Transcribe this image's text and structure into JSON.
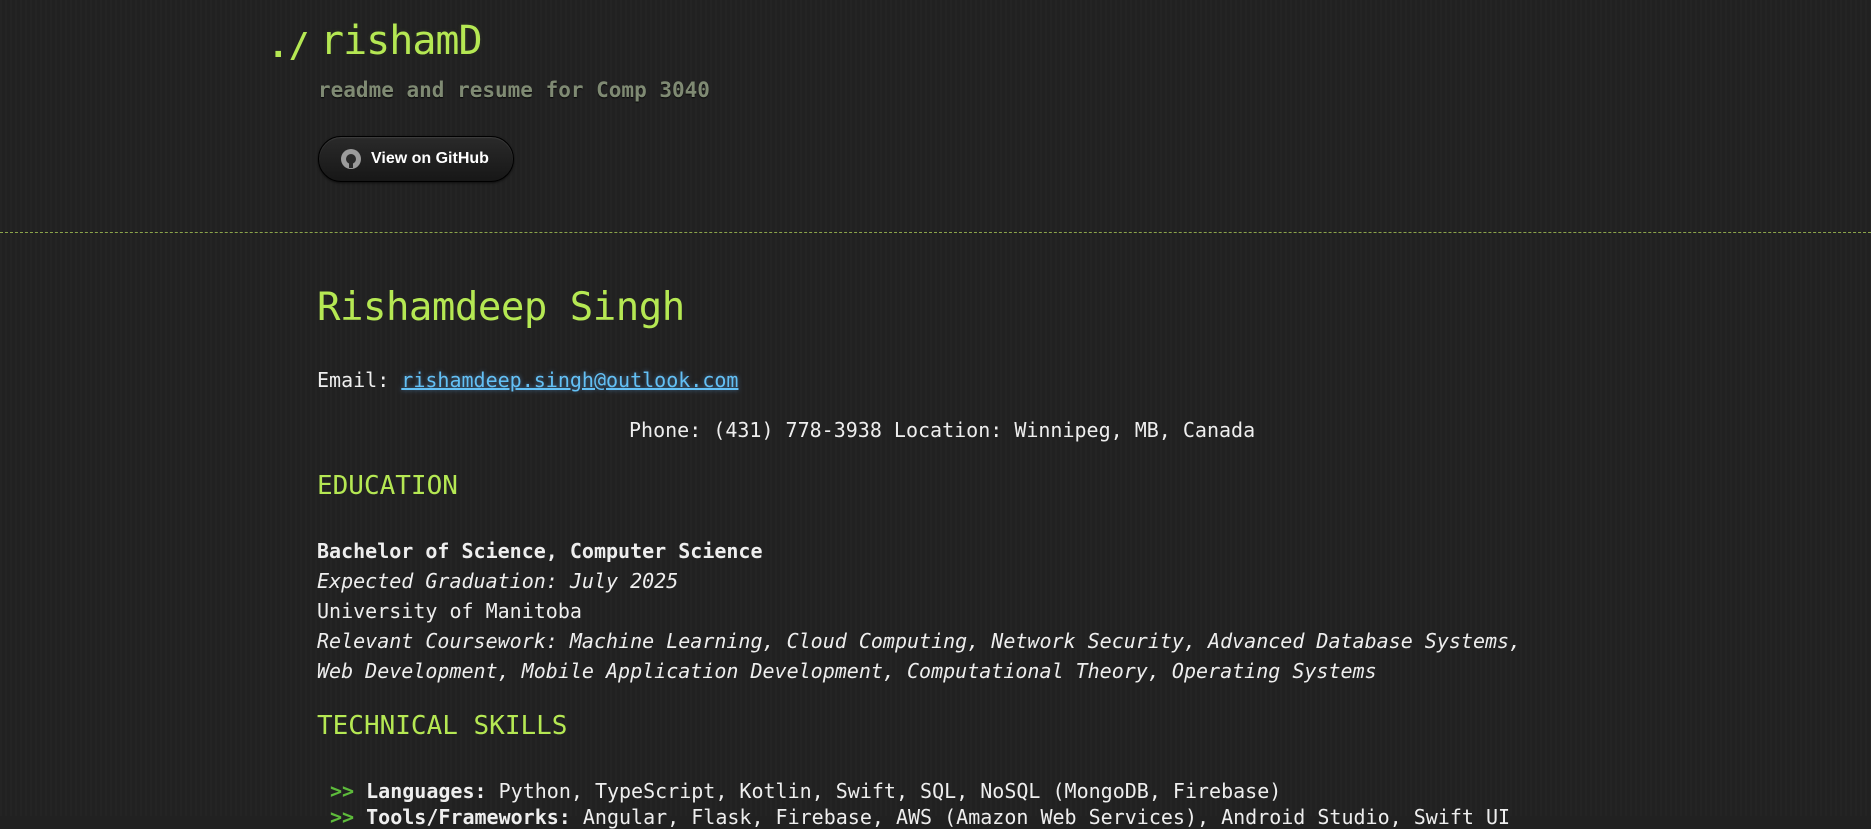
{
  "header": {
    "prefix": "./",
    "title": "rishamD",
    "description": "readme and resume for Comp 3040",
    "github_button_label": "View on GitHub"
  },
  "resume": {
    "name": "Rishamdeep Singh",
    "email_label": "Email:",
    "email": "rishamdeep.singh@outlook.com",
    "phone_location": "Phone: (431) 778-3938 Location: Winnipeg, MB, Canada",
    "education": {
      "heading": "EDUCATION",
      "degree": "Bachelor of Science, Computer Science",
      "graduation": "Expected Graduation: July 2025",
      "school": "University of Manitoba",
      "coursework_line1": "Relevant Coursework: Machine Learning, Cloud Computing, Network Security, Advanced Database Systems,",
      "coursework_line2": "Web Development, Mobile Application Development, Computational Theory, Operating Systems"
    },
    "skills": {
      "heading": "TECHNICAL SKILLS",
      "marker": ">>",
      "items": [
        {
          "label": "Languages:",
          "value": "Python, TypeScript, Kotlin, Swift, SQL, NoSQL (MongoDB, Firebase)"
        },
        {
          "label": "Tools/Frameworks:",
          "value": "Angular, Flask, Firebase, AWS (Amazon Web Services), Android Studio, Swift UI"
        }
      ]
    }
  },
  "colors": {
    "background": "#212121",
    "accent_green": "#b5e853",
    "link_blue": "#63c0f5",
    "muted_text": "#7f8a73",
    "marker_green": "#5dbb3b"
  }
}
